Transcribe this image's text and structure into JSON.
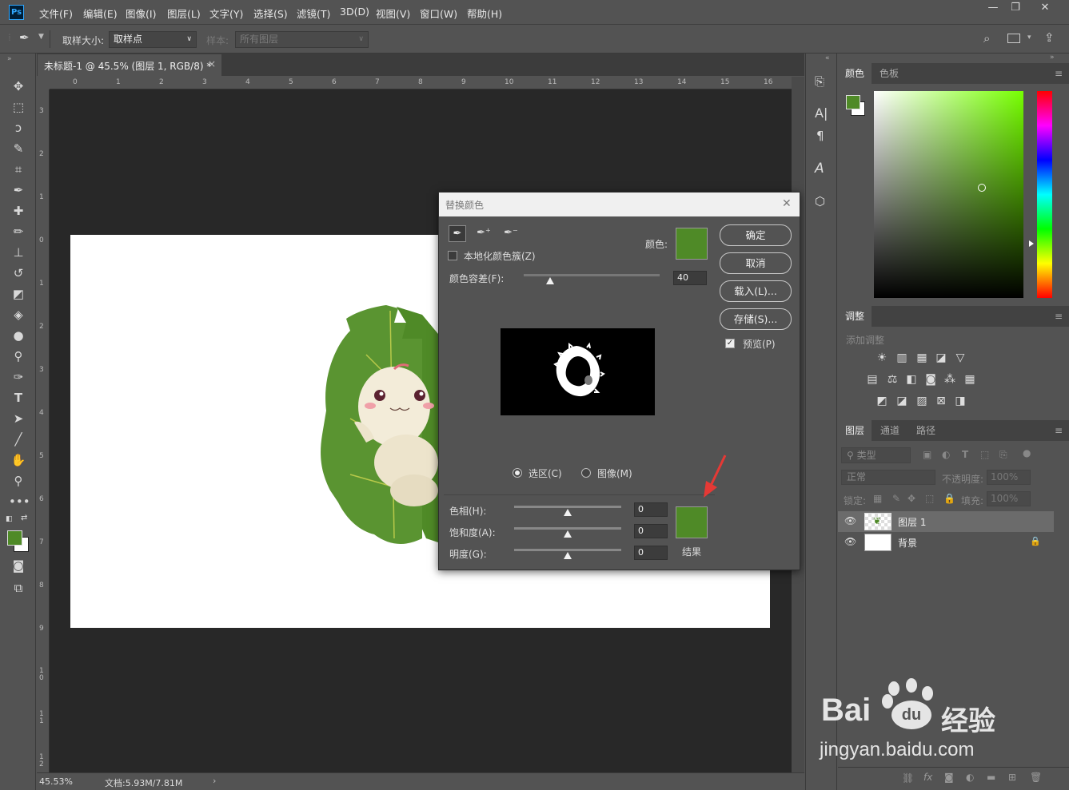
{
  "app": {
    "logo": "Ps"
  },
  "menu": [
    "文件(F)",
    "编辑(E)",
    "图像(I)",
    "图层(L)",
    "文字(Y)",
    "选择(S)",
    "滤镜(T)",
    "3D(D)",
    "视图(V)",
    "窗口(W)",
    "帮助(H)"
  ],
  "window_controls": {
    "minimize": "—",
    "restore": "❐",
    "close": "✕"
  },
  "options": {
    "sample_size_label": "取样大小:",
    "sample_size_value": "取样点",
    "sample_label": "样本:",
    "sample_value": "所有图层"
  },
  "document": {
    "tab_title": "未标题-1 @ 45.5% (图层 1, RGB/8) *",
    "tab_close": "×",
    "ruler_top": [
      "0",
      "1",
      "2",
      "3",
      "4",
      "5",
      "6",
      "7",
      "8",
      "9",
      "10",
      "11",
      "12",
      "13",
      "14",
      "15",
      "16"
    ],
    "ruler_left": [
      "3",
      "2",
      "1",
      "0",
      "1",
      "2",
      "3",
      "4",
      "5",
      "6",
      "7",
      "8",
      "9",
      "10",
      "11",
      "12"
    ],
    "zoom": "45.53%",
    "doc_info": "文档:5.93M/7.81M",
    "status_arrow": "›"
  },
  "dialog": {
    "title": "替换颜色",
    "close": "✕",
    "localized_label": "本地化颜色簇(Z)",
    "localized_checked": false,
    "color_label": "颜色:",
    "color_swatch": "#4f8a27",
    "fuzziness_label": "颜色容差(F):",
    "fuzziness_value": "40",
    "fuzziness_fraction": 0.2,
    "buttons": {
      "ok": "确定",
      "cancel": "取消",
      "load": "载入(L)...",
      "save": "存储(S)..."
    },
    "preview_label": "预览(P)",
    "preview_checked": true,
    "radio_selection": "选区(C)",
    "radio_image": "图像(M)",
    "selected_mode": "selection",
    "hue_label": "色相(H):",
    "hue_value": "0",
    "saturation_label": "饱和度(A):",
    "saturation_value": "0",
    "lightness_label": "明度(G):",
    "lightness_value": "0",
    "result_label": "结果",
    "result_swatch": "#4f8a27"
  },
  "panels": {
    "color_tabs": [
      "颜色",
      "色板"
    ],
    "fg_color": "#4f8a27",
    "bg_color": "#ffffff",
    "adjust_tab": "调整",
    "add_adjust": "添加调整",
    "layers_tabs": [
      "图层",
      "通道",
      "路径"
    ],
    "kind_filter": "类型",
    "blend_mode": "正常",
    "opacity_label": "不透明度:",
    "opacity_value": "100%",
    "lock_label": "锁定:",
    "fill_label": "填充:",
    "fill_value": "100%",
    "layers": [
      {
        "name": "图层 1",
        "visible": true,
        "selected": true
      },
      {
        "name": "背景",
        "visible": true,
        "selected": false,
        "locked": true
      }
    ],
    "bottom_icons": [
      "GD",
      "fx"
    ]
  },
  "watermark": {
    "brand": "Bai",
    "brand2": "du",
    "cn": "经验",
    "url": "jingyan.baidu.com"
  }
}
